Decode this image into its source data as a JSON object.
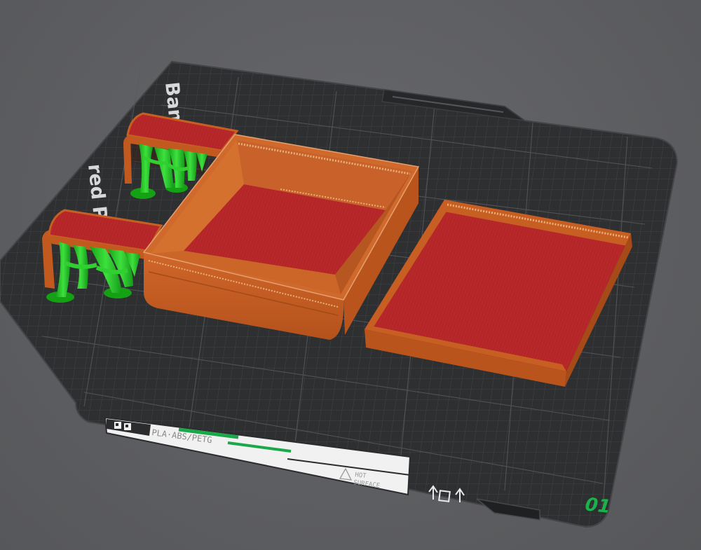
{
  "bed": {
    "brand_text": "Bambu Textured PEI Plate",
    "brand_text_line1": "Bamb",
    "brand_text_line2": "red Pl",
    "material_label": "PLA·ABS/PETG",
    "hot_surface_line1": "HOT",
    "hot_surface_line2": "SURFACE",
    "plate_number": "01"
  },
  "colors": {
    "background": "#5d5e61",
    "bed_surface": "#2e2f31",
    "grid_line": "#5e5f62",
    "part_orange": "#c85f22",
    "part_red_top": "#b8282a",
    "support_green": "#1fc21f",
    "plate_number": "#19b34a",
    "accent_green": "#1aa84a"
  },
  "objects": [
    {
      "name": "box-tray",
      "type": "model"
    },
    {
      "name": "box-lid",
      "type": "model"
    },
    {
      "name": "top-left-bracket",
      "type": "model"
    },
    {
      "name": "bottom-left-bracket",
      "type": "model"
    },
    {
      "name": "tree-supports",
      "type": "support"
    }
  ]
}
